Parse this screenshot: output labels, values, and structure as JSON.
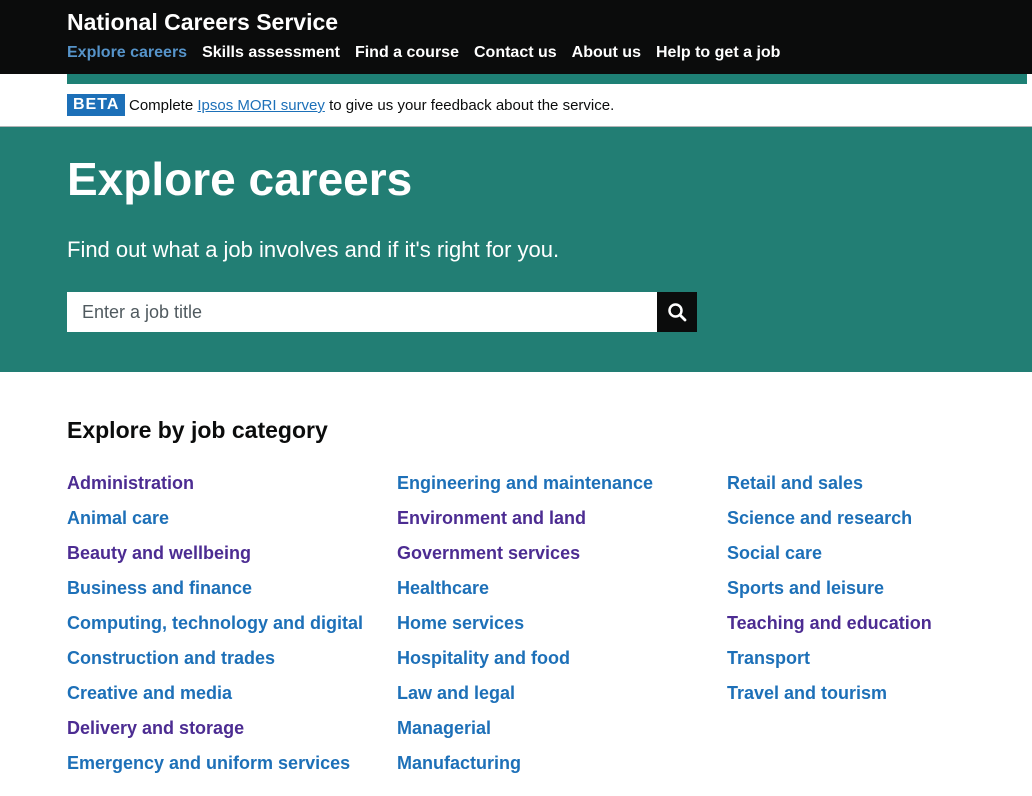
{
  "header": {
    "brand": "National Careers Service",
    "nav": [
      {
        "label": "Explore careers",
        "active": true
      },
      {
        "label": "Skills assessment",
        "active": false
      },
      {
        "label": "Find a course",
        "active": false
      },
      {
        "label": "Contact us",
        "active": false
      },
      {
        "label": "About us",
        "active": false
      },
      {
        "label": "Help to get a job",
        "active": false
      }
    ]
  },
  "beta": {
    "tag": "BETA",
    "text_before": "Complete ",
    "link": "Ipsos MORI survey",
    "text_after": " to give us your feedback about the service."
  },
  "hero": {
    "title": "Explore careers",
    "subtitle": "Find out what a job involves and if it's right for you.",
    "search_placeholder": "Enter a job title",
    "search_icon": "search-icon"
  },
  "categories": {
    "title": "Explore by job category",
    "columns": [
      [
        {
          "label": "Administration",
          "visited": true
        },
        {
          "label": "Animal care",
          "visited": false
        },
        {
          "label": "Beauty and wellbeing",
          "visited": true
        },
        {
          "label": "Business and finance",
          "visited": false
        },
        {
          "label": "Computing, technology and digital",
          "visited": false
        },
        {
          "label": "Construction and trades",
          "visited": false
        },
        {
          "label": "Creative and media",
          "visited": false
        },
        {
          "label": "Delivery and storage",
          "visited": true
        },
        {
          "label": "Emergency and uniform services",
          "visited": false
        }
      ],
      [
        {
          "label": "Engineering and maintenance",
          "visited": false
        },
        {
          "label": "Environment and land",
          "visited": true
        },
        {
          "label": "Government services",
          "visited": true
        },
        {
          "label": "Healthcare",
          "visited": false
        },
        {
          "label": "Home services",
          "visited": false
        },
        {
          "label": "Hospitality and food",
          "visited": false
        },
        {
          "label": "Law and legal",
          "visited": false
        },
        {
          "label": "Managerial",
          "visited": false
        },
        {
          "label": "Manufacturing",
          "visited": false
        }
      ],
      [
        {
          "label": "Retail and sales",
          "visited": false
        },
        {
          "label": "Science and research",
          "visited": false
        },
        {
          "label": "Social care",
          "visited": false
        },
        {
          "label": "Sports and leisure",
          "visited": false
        },
        {
          "label": "Teaching and education",
          "visited": true
        },
        {
          "label": "Transport",
          "visited": false
        },
        {
          "label": "Travel and tourism",
          "visited": false
        }
      ]
    ]
  },
  "colors": {
    "header_bg": "#0b0c0c",
    "hero_bg": "#227e74",
    "link": "#1d70b8",
    "link_visited": "#4c2c92",
    "nav_active": "#5694ca"
  }
}
